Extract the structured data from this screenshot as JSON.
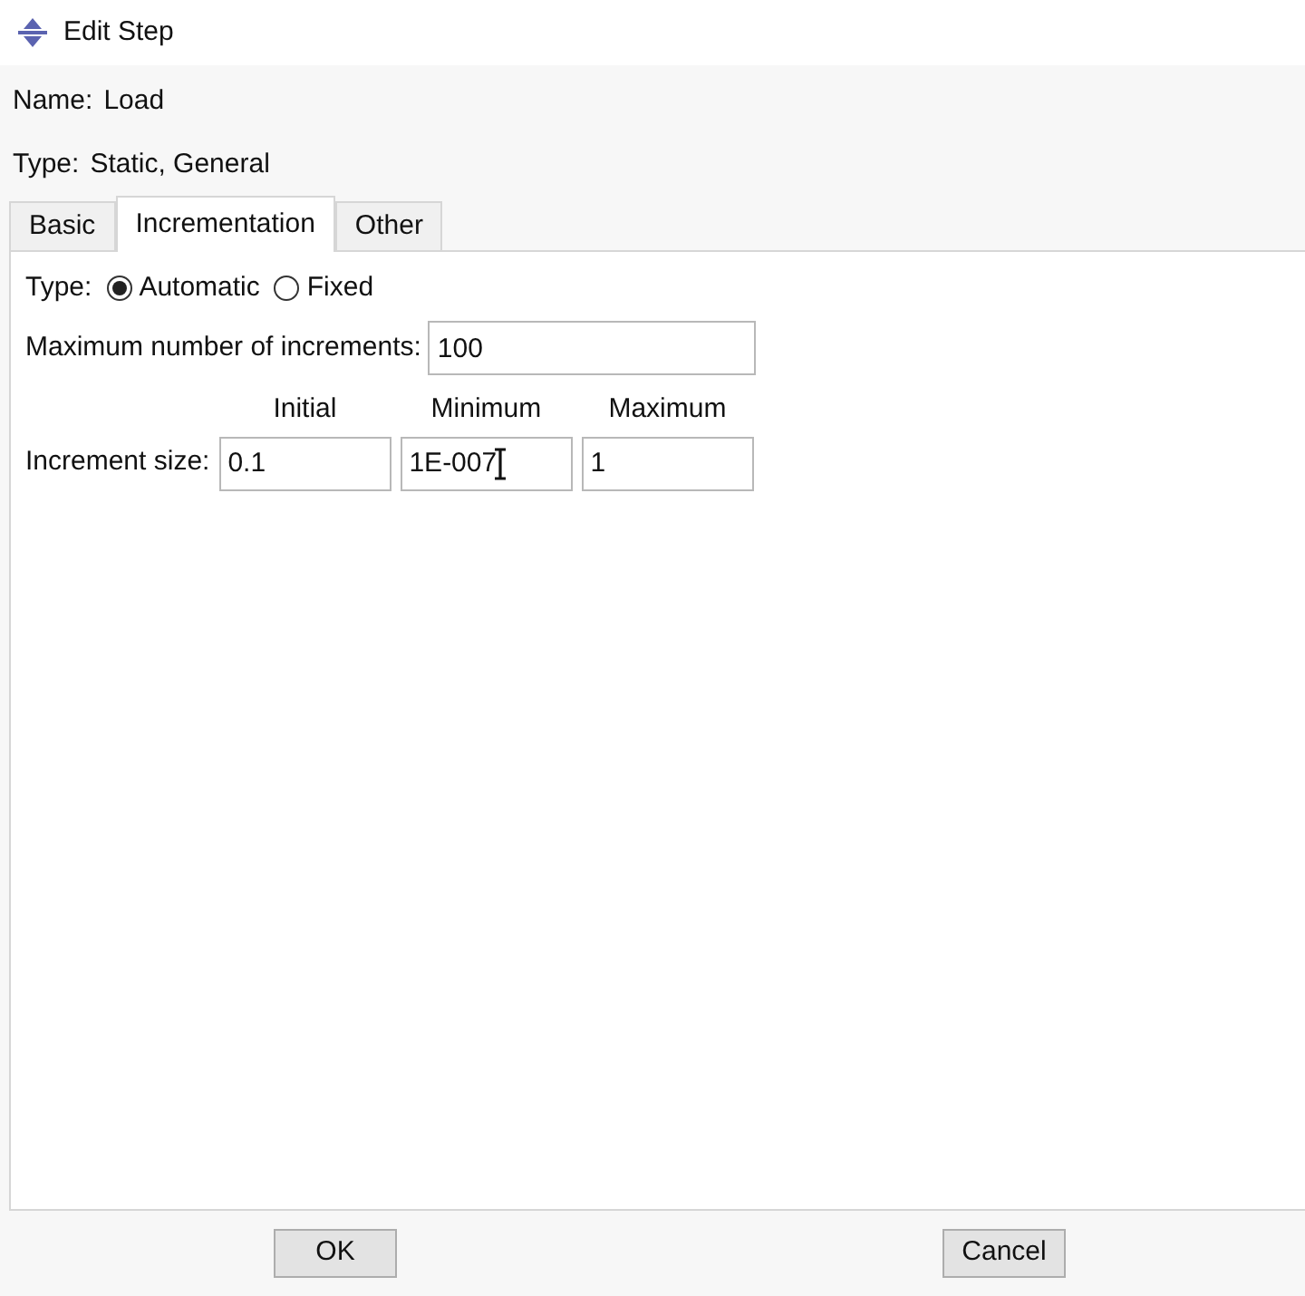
{
  "window": {
    "title": "Edit Step"
  },
  "step_info": [
    {
      "label": "Name:",
      "value": "Load"
    },
    {
      "label": "Type:",
      "value": "Static, General"
    }
  ],
  "tabs": [
    {
      "label": "Basic",
      "selected": false
    },
    {
      "label": "Incrementation",
      "selected": true
    },
    {
      "label": "Other",
      "selected": false
    }
  ],
  "increment_type": {
    "label": "Type:",
    "options": [
      {
        "label": "Automatic",
        "selected": true
      },
      {
        "label": "Fixed",
        "selected": false
      }
    ]
  },
  "max_increments": {
    "label": "Maximum number of increments:",
    "value": "100"
  },
  "increment_size": {
    "label": "Increment size:",
    "columns": [
      {
        "heading": "Initial",
        "value": "0.1",
        "text_cursor": false
      },
      {
        "heading": "Minimum",
        "value": "1E-007",
        "text_cursor": true
      },
      {
        "heading": "Maximum",
        "value": "1",
        "text_cursor": false
      }
    ]
  },
  "buttons": [
    "OK",
    "Cancel"
  ]
}
